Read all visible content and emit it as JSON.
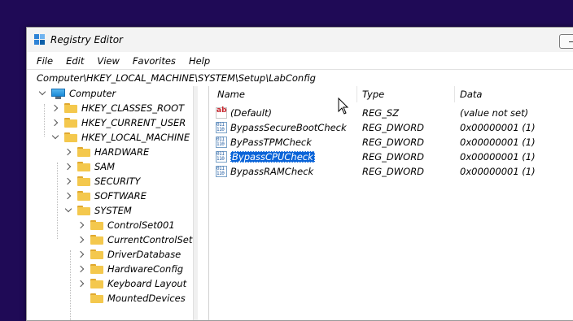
{
  "window": {
    "title": "Registry Editor"
  },
  "menu": [
    "File",
    "Edit",
    "View",
    "Favorites",
    "Help"
  ],
  "address": "Computer\\HKEY_LOCAL_MACHINE\\SYSTEM\\Setup\\LabConfig",
  "tree": {
    "root": "Computer",
    "items": [
      {
        "label": "HKEY_CLASSES_ROOT",
        "expanded": false
      },
      {
        "label": "HKEY_CURRENT_USER",
        "expanded": false
      },
      {
        "label": "HKEY_LOCAL_MACHINE",
        "expanded": true
      },
      {
        "label": "HARDWARE",
        "expanded": false
      },
      {
        "label": "SAM",
        "expanded": false
      },
      {
        "label": "SECURITY",
        "expanded": false
      },
      {
        "label": "SOFTWARE",
        "expanded": false
      },
      {
        "label": "SYSTEM",
        "expanded": true
      },
      {
        "label": "ControlSet001",
        "expanded": false
      },
      {
        "label": "CurrentControlSet",
        "expanded": false
      },
      {
        "label": "DriverDatabase",
        "expanded": false
      },
      {
        "label": "HardwareConfig",
        "expanded": false
      },
      {
        "label": "Keyboard Layout",
        "expanded": false
      },
      {
        "label": "MountedDevices",
        "expanded": false
      }
    ]
  },
  "list": {
    "columns": [
      "Name",
      "Type",
      "Data"
    ],
    "rows": [
      {
        "name": "(Default)",
        "type": "REG_SZ",
        "data": "(value not set)",
        "icon": "string-value-icon"
      },
      {
        "name": "BypassSecureBootCheck",
        "type": "REG_DWORD",
        "data": "0x00000001 (1)",
        "icon": "binary-value-icon"
      },
      {
        "name": "ByPassTPMCheck",
        "type": "REG_DWORD",
        "data": "0x00000001 (1)",
        "icon": "binary-value-icon"
      },
      {
        "name": "BypassCPUCheck",
        "type": "REG_DWORD",
        "data": "0x00000001 (1)",
        "icon": "binary-value-icon",
        "selected": true
      },
      {
        "name": "BypassRAMCheck",
        "type": "REG_DWORD",
        "data": "0x00000001 (1)",
        "icon": "binary-value-icon"
      }
    ]
  },
  "colors": {
    "desktop": "#1f0a56",
    "selection": "#0a64d8",
    "folder": "#f4c84d"
  }
}
